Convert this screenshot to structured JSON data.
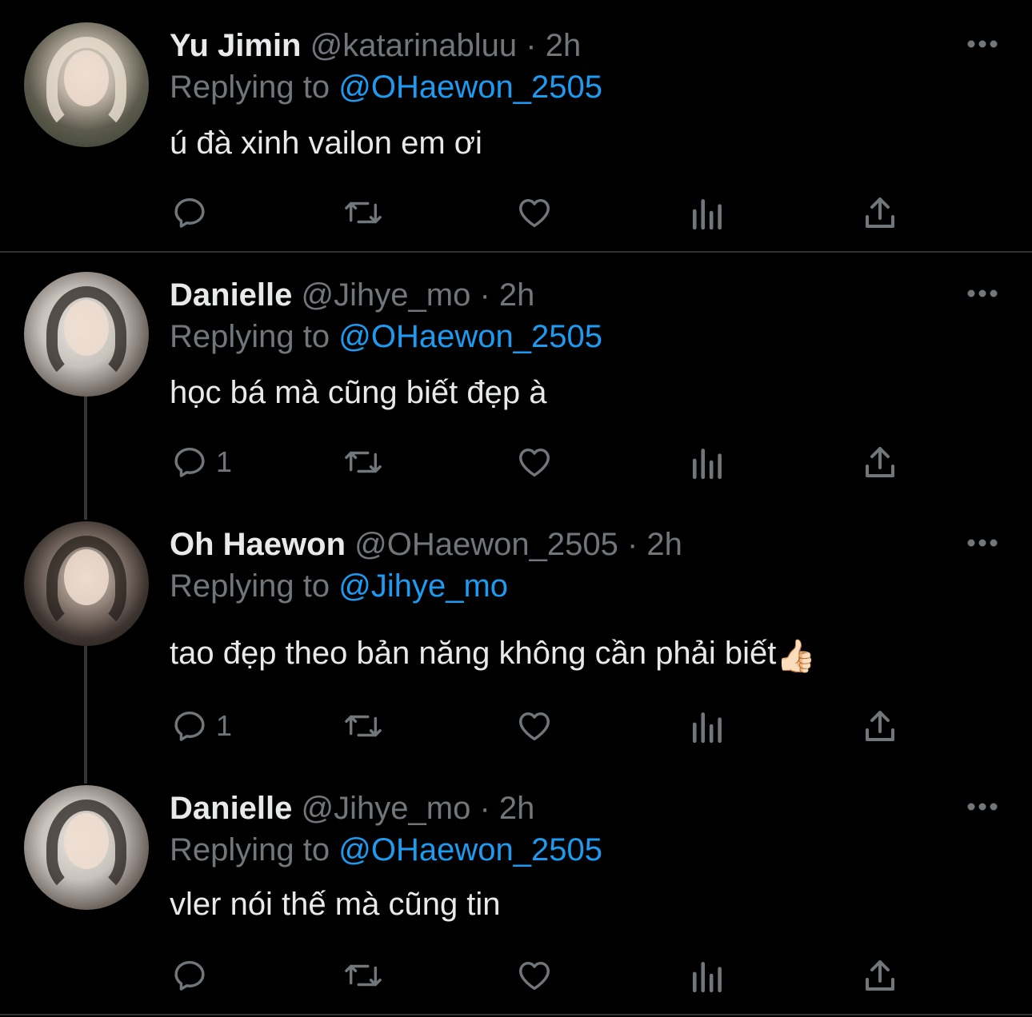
{
  "colors": {
    "background": "#000000",
    "text": "#e7e9ea",
    "muted": "#71767b",
    "link": "#1d9bf0",
    "divider": "#2f3336"
  },
  "tweets": [
    {
      "name": "Yu Jimin",
      "handle": "@katarinabluu",
      "time": "· 2h",
      "replying_prefix": "Replying to",
      "replying_to": "@OHaewon_2505",
      "text": "ú đà xinh vailon em ơi",
      "reply_count": ""
    },
    {
      "name": "Danielle",
      "handle": "@Jihye_mo",
      "time": "· 2h",
      "replying_prefix": "Replying to",
      "replying_to": "@OHaewon_2505",
      "text": "học bá mà cũng biết đẹp à",
      "reply_count": "1"
    },
    {
      "name": "Oh Haewon",
      "handle": "@OHaewon_2505",
      "time": "· 2h",
      "replying_prefix": "Replying to",
      "replying_to": "@Jihye_mo",
      "text": "tao đẹp theo bản năng không cần phải biết",
      "emoji": "👍🏻",
      "reply_count": "1"
    },
    {
      "name": "Danielle",
      "handle": "@Jihye_mo",
      "time": "· 2h",
      "replying_prefix": "Replying to",
      "replying_to": "@OHaewon_2505",
      "text": "vler nói thế mà cũng tin",
      "reply_count": ""
    }
  ],
  "icons": [
    "reply-icon",
    "retweet-icon",
    "like-icon",
    "views-icon",
    "share-icon",
    "more-icon"
  ]
}
